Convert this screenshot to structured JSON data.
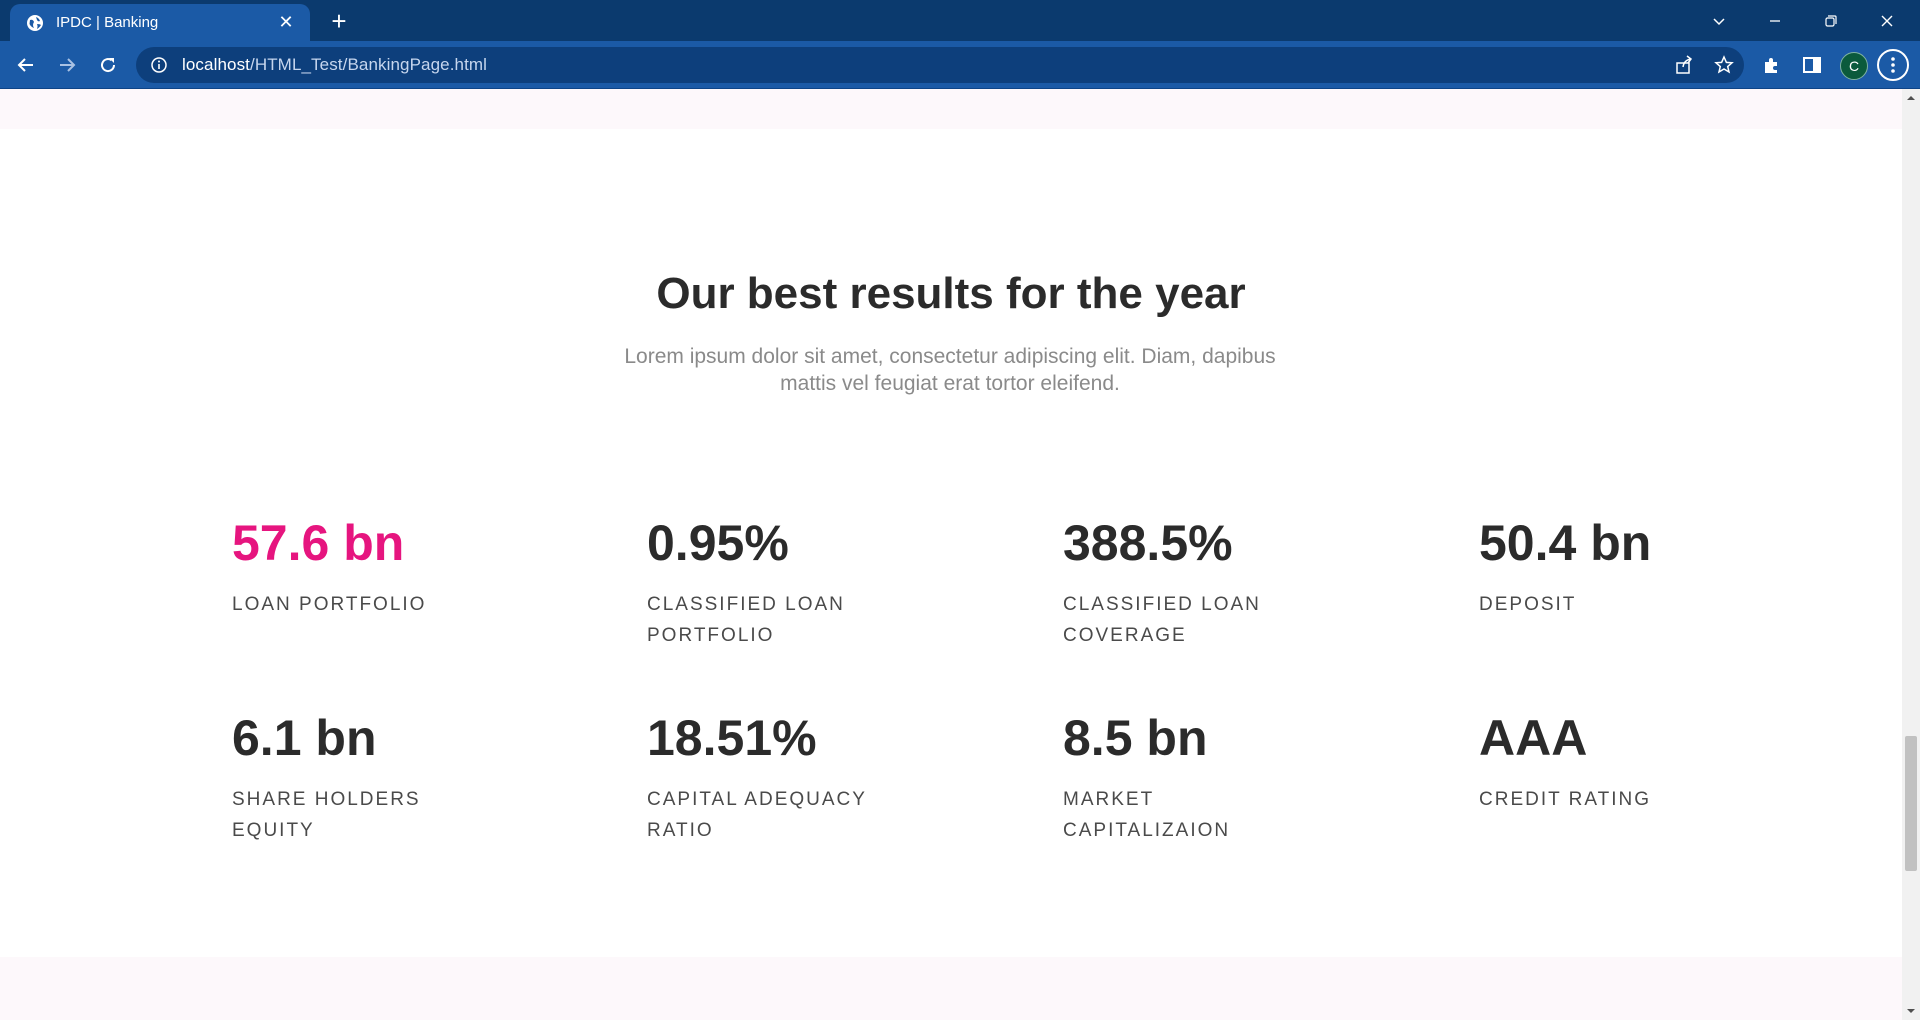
{
  "browser": {
    "tab_title": "IPDC | Banking",
    "tab_close": "✕",
    "new_tab": "+",
    "url_host": "localhost",
    "url_path": "/HTML_Test/BankingPage.html",
    "profile_initial": "C"
  },
  "section": {
    "heading": "Our best results for the year",
    "subtext": "Lorem ipsum dolor sit amet, consectetur adipiscing elit. Diam, dapibus mattis vel feugiat erat tortor eleifend."
  },
  "stats": [
    {
      "value": "57.6 bn",
      "label": "LOAN PORTFOLIO"
    },
    {
      "value": "0.95%",
      "label": "CLASSIFIED LOAN PORTFOLIO"
    },
    {
      "value": "388.5%",
      "label": "CLASSIFIED LOAN COVERAGE"
    },
    {
      "value": "50.4 bn",
      "label": "DEPOSIT"
    },
    {
      "value": "6.1 bn",
      "label": "SHARE HOLDERS EQUITY"
    },
    {
      "value": "18.51%",
      "label": "CAPITAL ADEQUACY RATIO"
    },
    {
      "value": "8.5 bn",
      "label": "MARKET CAPITALIZAION"
    },
    {
      "value": "AAA",
      "label": "CREDIT RATING"
    }
  ],
  "colors": {
    "accent": "#e6157f",
    "chrome_dark": "#0b3a6e",
    "chrome": "#1b5aa6",
    "text_dark": "#2b2b2b",
    "text_muted": "#8a8a8a"
  },
  "icons": [
    "globe-icon",
    "close-icon",
    "plus-icon",
    "back-icon",
    "forward-icon",
    "reload-icon",
    "info-icon",
    "share-icon",
    "star-icon",
    "extensions-icon",
    "sidepanel-icon",
    "kebab-menu-icon",
    "minimize-icon",
    "restore-icon",
    "window-close-icon",
    "tab-search-icon"
  ]
}
